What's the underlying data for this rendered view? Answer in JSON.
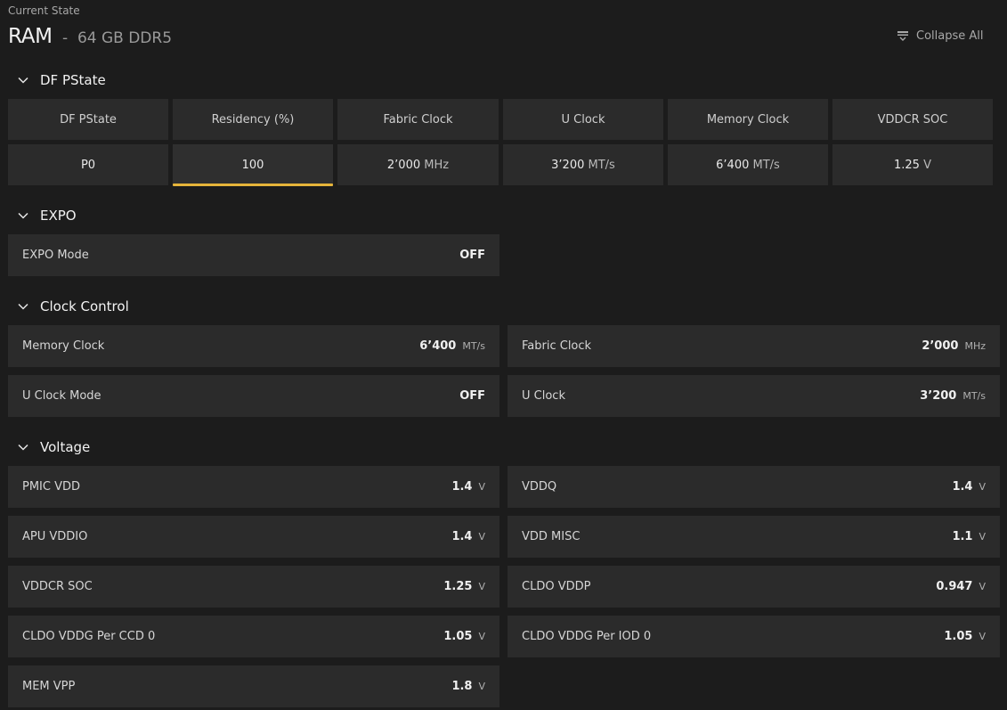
{
  "header": {
    "breadcrumb": "Current State",
    "title": "RAM",
    "subtitle": "-  64 GB DDR5",
    "collapse_label": "Collapse All"
  },
  "sections": {
    "dfpstate": {
      "title": "DF PState",
      "columns": [
        "DF PState",
        "Residency (%)",
        "Fabric Clock",
        "U Clock",
        "Memory Clock",
        "VDDCR SOC"
      ],
      "values": [
        {
          "value": "P0",
          "unit": ""
        },
        {
          "value": "100",
          "unit": ""
        },
        {
          "value": "2’000",
          "unit": "MHz"
        },
        {
          "value": "3’200",
          "unit": "MT/s"
        },
        {
          "value": "6’400",
          "unit": "MT/s"
        },
        {
          "value": "1.25",
          "unit": "V"
        }
      ],
      "selected_column": "Residency (%)"
    },
    "expo": {
      "title": "EXPO",
      "items": [
        {
          "label": "EXPO Mode",
          "value": "OFF",
          "unit": ""
        }
      ]
    },
    "clock_control": {
      "title": "Clock Control",
      "items": [
        {
          "label": "Memory Clock",
          "value": "6’400",
          "unit": "MT/s"
        },
        {
          "label": "Fabric Clock",
          "value": "2’000",
          "unit": "MHz"
        },
        {
          "label": "U Clock Mode",
          "value": "OFF",
          "unit": ""
        },
        {
          "label": "U Clock",
          "value": "3’200",
          "unit": "MT/s"
        }
      ]
    },
    "voltage": {
      "title": "Voltage",
      "items": [
        {
          "label": "PMIC VDD",
          "value": "1.4",
          "unit": "V"
        },
        {
          "label": "VDDQ",
          "value": "1.4",
          "unit": "V"
        },
        {
          "label": "APU VDDIO",
          "value": "1.4",
          "unit": "V"
        },
        {
          "label": "VDD MISC",
          "value": "1.1",
          "unit": "V"
        },
        {
          "label": "VDDCR SOC",
          "value": "1.25",
          "unit": "V"
        },
        {
          "label": "CLDO VDDP",
          "value": "0.947",
          "unit": "V"
        },
        {
          "label": "CLDO VDDG Per CCD 0",
          "value": "1.05",
          "unit": "V"
        },
        {
          "label": "CLDO VDDG Per IOD 0",
          "value": "1.05",
          "unit": "V"
        },
        {
          "label": "MEM VPP",
          "value": "1.8",
          "unit": "V"
        }
      ]
    }
  },
  "icons": {
    "section_toggle": "chevron-down-icon",
    "collapse_all": "collapse-all-icon"
  },
  "colors": {
    "accent": "#e5b43a",
    "background": "#1c1c1c",
    "card": "#2b2b2b"
  }
}
